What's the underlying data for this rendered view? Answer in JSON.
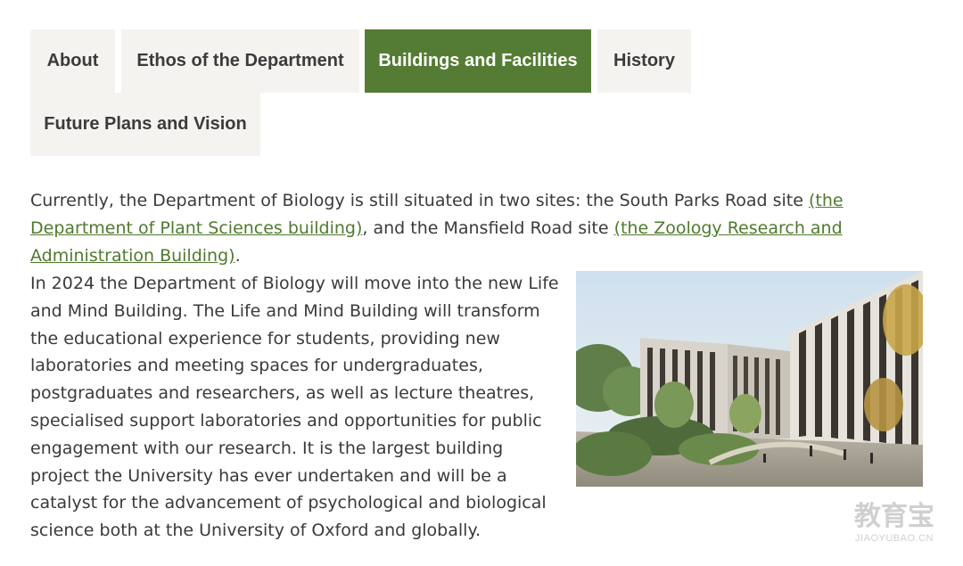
{
  "tabs": [
    {
      "label": "About",
      "active": false
    },
    {
      "label": "Ethos of the Department",
      "active": false
    },
    {
      "label": "Buildings and Facilities",
      "active": true
    },
    {
      "label": "History",
      "active": false
    },
    {
      "label": "Future Plans and Vision",
      "active": false
    }
  ],
  "intro": {
    "text_1": "Currently, the Department of Biology is still situated in two sites: the South Parks Road site ",
    "link_1": "(the Department of Plant Sciences building)",
    "text_2": ", and the Mansfield Road site ",
    "link_2": "(the Zoology Research and Administration Building)",
    "text_3": "."
  },
  "main": {
    "paragraph": "In 2024 the Department of Biology will move into the new Life and Mind Building. The Life and Mind Building will transform the educational experience for students, providing new laboratories and meeting spaces for undergraduates, postgraduates and researchers, as well as lecture theatres, specialised support laboratories and opportunities for public engagement with our research. It is the largest building project the University has ever undertaken and will be a catalyst for the advancement of psychological and biological science both at the University of Oxford and globally."
  },
  "watermark": {
    "main": "教育宝",
    "sub": "JIAOYUBAO.CN"
  },
  "colors": {
    "accent": "#557c34",
    "tab_bg": "#f5f3f0",
    "link": "#4f7a2d",
    "text": "#3a3a3a"
  }
}
